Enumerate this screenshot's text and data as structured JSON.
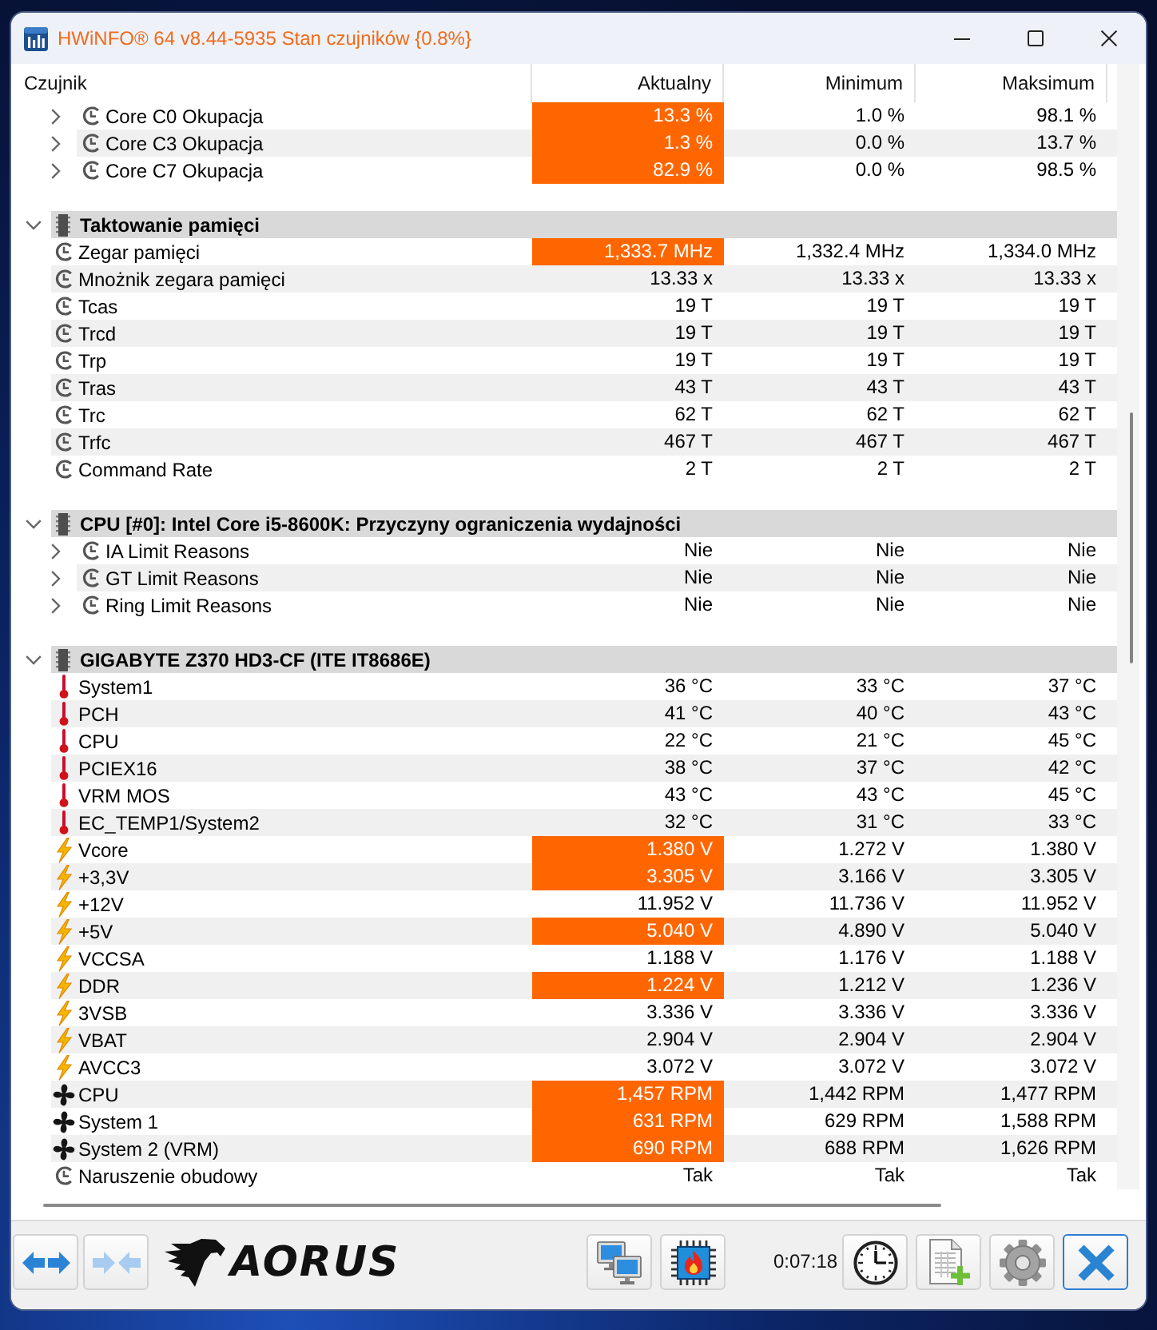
{
  "window": {
    "title": "HWiNFO® 64 v8.44-5935 Stan czujników {0.8%}"
  },
  "columns": [
    "Czujnik",
    "Aktualny",
    "Minimum",
    "Maksimum"
  ],
  "groups": [
    {
      "rows": [
        {
          "kind": "clock",
          "name": "Core C0 Okupacja",
          "expanded": false,
          "highlighted": true,
          "current": "13.3 %",
          "minimum": "1.0 %",
          "maximum": "98.1 %"
        },
        {
          "kind": "clock",
          "name": "Core C3 Okupacja",
          "expanded": false,
          "highlighted": true,
          "current": "1.3 %",
          "minimum": "0.0 %",
          "maximum": "13.7 %"
        },
        {
          "kind": "clock",
          "name": "Core C7 Okupacja",
          "expanded": false,
          "highlighted": true,
          "current": "82.9 %",
          "minimum": "0.0 %",
          "maximum": "98.5 %"
        }
      ]
    },
    {
      "title": "Taktowanie pamięci",
      "expanded": true,
      "rows": [
        {
          "kind": "clock",
          "name": "Zegar pamięci",
          "highlighted": true,
          "current": "1,333.7 MHz",
          "minimum": "1,332.4 MHz",
          "maximum": "1,334.0 MHz"
        },
        {
          "kind": "clock",
          "name": "Mnożnik zegara pamięci",
          "highlighted": false,
          "current": "13.33 x",
          "minimum": "13.33 x",
          "maximum": "13.33 x"
        },
        {
          "kind": "clock",
          "name": "Tcas",
          "highlighted": false,
          "current": "19 T",
          "minimum": "19 T",
          "maximum": "19 T"
        },
        {
          "kind": "clock",
          "name": "Trcd",
          "highlighted": false,
          "current": "19 T",
          "minimum": "19 T",
          "maximum": "19 T"
        },
        {
          "kind": "clock",
          "name": "Trp",
          "highlighted": false,
          "current": "19 T",
          "minimum": "19 T",
          "maximum": "19 T"
        },
        {
          "kind": "clock",
          "name": "Tras",
          "highlighted": false,
          "current": "43 T",
          "minimum": "43 T",
          "maximum": "43 T"
        },
        {
          "kind": "clock",
          "name": "Trc",
          "highlighted": false,
          "current": "62 T",
          "minimum": "62 T",
          "maximum": "62 T"
        },
        {
          "kind": "clock",
          "name": "Trfc",
          "highlighted": false,
          "current": "467 T",
          "minimum": "467 T",
          "maximum": "467 T"
        },
        {
          "kind": "clock",
          "name": "Command Rate",
          "highlighted": false,
          "current": "2 T",
          "minimum": "2 T",
          "maximum": "2 T"
        }
      ]
    },
    {
      "title": "CPU [#0]: Intel Core i5-8600K: Przyczyny ograniczenia wydajności",
      "expanded": true,
      "rows": [
        {
          "kind": "clock",
          "name": "IA Limit Reasons",
          "expanded": false,
          "highlighted": false,
          "current": "Nie",
          "minimum": "Nie",
          "maximum": "Nie"
        },
        {
          "kind": "clock",
          "name": "GT Limit Reasons",
          "expanded": false,
          "highlighted": false,
          "current": "Nie",
          "minimum": "Nie",
          "maximum": "Nie"
        },
        {
          "kind": "clock",
          "name": "Ring Limit Reasons",
          "expanded": false,
          "highlighted": false,
          "current": "Nie",
          "minimum": "Nie",
          "maximum": "Nie"
        }
      ]
    },
    {
      "title": "GIGABYTE Z370 HD3-CF (ITE IT8686E)",
      "expanded": true,
      "rows": [
        {
          "kind": "temperature",
          "name": "System1",
          "highlighted": false,
          "current": "36 °C",
          "minimum": "33 °C",
          "maximum": "37 °C"
        },
        {
          "kind": "temperature",
          "name": "PCH",
          "highlighted": false,
          "current": "41 °C",
          "minimum": "40 °C",
          "maximum": "43 °C"
        },
        {
          "kind": "temperature",
          "name": "CPU",
          "highlighted": false,
          "current": "22 °C",
          "minimum": "21 °C",
          "maximum": "45 °C"
        },
        {
          "kind": "temperature",
          "name": "PCIEX16",
          "highlighted": false,
          "current": "38 °C",
          "minimum": "37 °C",
          "maximum": "42 °C"
        },
        {
          "kind": "temperature",
          "name": "VRM MOS",
          "highlighted": false,
          "current": "43 °C",
          "minimum": "43 °C",
          "maximum": "45 °C"
        },
        {
          "kind": "temperature",
          "name": "EC_TEMP1/System2",
          "highlighted": false,
          "current": "32 °C",
          "minimum": "31 °C",
          "maximum": "33 °C"
        },
        {
          "kind": "voltage",
          "name": "Vcore",
          "highlighted": true,
          "current": "1.380 V",
          "minimum": "1.272 V",
          "maximum": "1.380 V"
        },
        {
          "kind": "voltage",
          "name": "+3,3V",
          "highlighted": true,
          "current": "3.305 V",
          "minimum": "3.166 V",
          "maximum": "3.305 V"
        },
        {
          "kind": "voltage",
          "name": "+12V",
          "highlighted": false,
          "current": "11.952 V",
          "minimum": "11.736 V",
          "maximum": "11.952 V"
        },
        {
          "kind": "voltage",
          "name": "+5V",
          "highlighted": true,
          "current": "5.040 V",
          "minimum": "4.890 V",
          "maximum": "5.040 V"
        },
        {
          "kind": "voltage",
          "name": "VCCSA",
          "highlighted": false,
          "current": "1.188 V",
          "minimum": "1.176 V",
          "maximum": "1.188 V"
        },
        {
          "kind": "voltage",
          "name": "DDR",
          "highlighted": true,
          "current": "1.224 V",
          "minimum": "1.212 V",
          "maximum": "1.236 V"
        },
        {
          "kind": "voltage",
          "name": "3VSB",
          "highlighted": false,
          "current": "3.336 V",
          "minimum": "3.336 V",
          "maximum": "3.336 V"
        },
        {
          "kind": "voltage",
          "name": "VBAT",
          "highlighted": false,
          "current": "2.904 V",
          "minimum": "2.904 V",
          "maximum": "2.904 V"
        },
        {
          "kind": "voltage",
          "name": "AVCC3",
          "highlighted": false,
          "current": "3.072 V",
          "minimum": "3.072 V",
          "maximum": "3.072 V"
        },
        {
          "kind": "fan",
          "name": "CPU",
          "highlighted": true,
          "current": "1,457 RPM",
          "minimum": "1,442 RPM",
          "maximum": "1,477 RPM"
        },
        {
          "kind": "fan",
          "name": "System 1",
          "highlighted": true,
          "current": "631 RPM",
          "minimum": "629 RPM",
          "maximum": "1,588 RPM"
        },
        {
          "kind": "fan",
          "name": "System 2 (VRM)",
          "highlighted": true,
          "current": "690 RPM",
          "minimum": "688 RPM",
          "maximum": "1,626 RPM"
        },
        {
          "kind": "clock",
          "name": "Naruszenie obudowy",
          "highlighted": false,
          "current": "Tak",
          "minimum": "Tak",
          "maximum": "Tak"
        }
      ]
    }
  ],
  "toolbar": {
    "nav_buttons": [
      {
        "kind": "expand",
        "disabled": false
      },
      {
        "kind": "collapse",
        "disabled": true
      }
    ],
    "logo": "AORUS",
    "tool_buttons": [
      {
        "kind": "network"
      },
      {
        "kind": "sensor"
      }
    ],
    "timer": "0:07:18",
    "action_buttons": [
      {
        "kind": "clock",
        "focused": false
      },
      {
        "kind": "report",
        "focused": false
      },
      {
        "kind": "settings",
        "focused": false
      },
      {
        "kind": "close",
        "focused": true
      }
    ]
  }
}
